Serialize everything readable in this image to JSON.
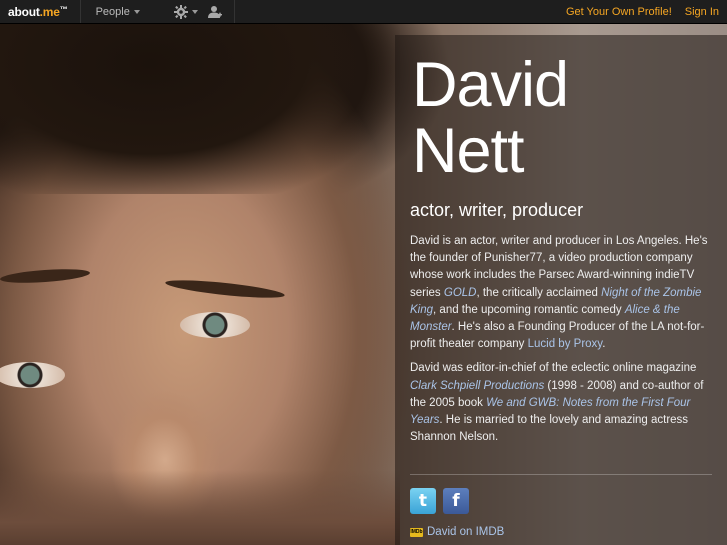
{
  "topbar": {
    "logo_main": "about",
    "logo_accent": ".me",
    "logo_tm": "™",
    "people_label": "People",
    "get_profile_label": "Get Your Own Profile!",
    "sign_in_label": "Sign In",
    "accent_color": "#f5a623"
  },
  "profile": {
    "first_name": "David",
    "last_name": "Nett",
    "headline": "actor, writer, producer",
    "bio_p1": [
      {
        "text": "David is an actor, writer and producer in Los Angeles. He's the founder of Punisher77, a video production company whose work includes the Parsec Award-winning indieTV series ",
        "type": "text"
      },
      {
        "text": "GOLD",
        "type": "em"
      },
      {
        "text": ", the critically acclaimed ",
        "type": "text"
      },
      {
        "text": "Night of the Zombie King",
        "type": "em"
      },
      {
        "text": ", and the upcoming romantic comedy ",
        "type": "text"
      },
      {
        "text": "Alice & the Monster",
        "type": "em"
      },
      {
        "text": ". He's also a Founding Producer of the LA not-for-profit theater company ",
        "type": "text"
      },
      {
        "text": "Lucid by Proxy",
        "type": "link"
      },
      {
        "text": ".",
        "type": "text"
      }
    ],
    "bio_p2": [
      {
        "text": "David was editor-in-chief of the eclectic online magazine ",
        "type": "text"
      },
      {
        "text": "Clark Schpiell Productions",
        "type": "em"
      },
      {
        "text": " (1998 - 2008) and co-author of the 2005 book ",
        "type": "text"
      },
      {
        "text": "We and GWB: Notes from the First Four Years",
        "type": "em"
      },
      {
        "text": ". He is married to the lovely and amazing actress Shannon Nelson.",
        "type": "text"
      }
    ],
    "social": [
      {
        "name": "twitter-icon",
        "glyph": "t"
      },
      {
        "name": "facebook-icon",
        "glyph": "f"
      }
    ],
    "imdb_badge": "IMDb",
    "imdb_label": "David on IMDB",
    "link_color": "#aac4e8"
  }
}
